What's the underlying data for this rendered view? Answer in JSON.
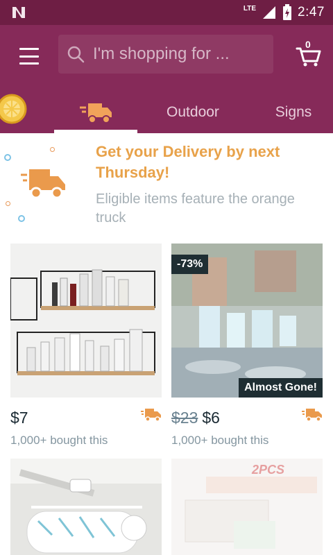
{
  "status_bar": {
    "network": "LTE",
    "time": "2:47"
  },
  "header": {
    "search_placeholder": "I'm shopping for ...",
    "cart_count": "0"
  },
  "tabs": [
    {
      "label": "",
      "icon": "coin-icon"
    },
    {
      "label": "",
      "icon": "delivery-truck-icon",
      "selected": true
    },
    {
      "label": "Outdoor"
    },
    {
      "label": "Signs"
    }
  ],
  "banner": {
    "title": "Get your Delivery by next Thursday!",
    "subtitle": "Eligible items feature the orange truck"
  },
  "products": [
    {
      "price": "$7",
      "old_price": "",
      "bought": "1,000+ bought this",
      "discount": "",
      "status": "",
      "fast_delivery": true
    },
    {
      "price": "$6",
      "old_price": "$23",
      "bought": "1,000+ bought this",
      "discount": "-73%",
      "status": "Almost Gone!",
      "fast_delivery": true
    },
    {
      "price": "",
      "old_price": "",
      "bought": "",
      "discount": "",
      "status": "",
      "fast_delivery": false
    },
    {
      "price": "",
      "old_price": "",
      "bought": "",
      "discount": "",
      "status": "",
      "fast_delivery": false,
      "image_text": "2PCS"
    }
  ],
  "colors": {
    "status_bar": "#6e1e44",
    "header": "#862a59",
    "accent_orange": "#e8a24a",
    "text_dark": "#1a2a33",
    "text_muted": "#8496a0"
  }
}
